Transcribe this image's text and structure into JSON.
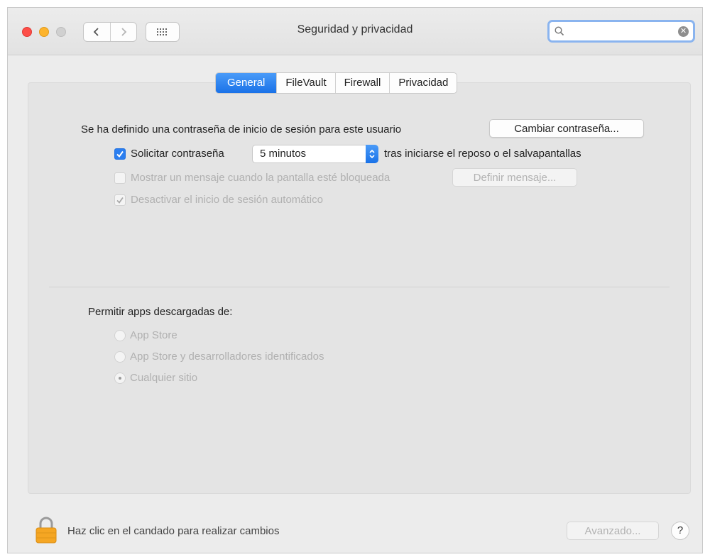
{
  "window": {
    "title": "Seguridad y privacidad"
  },
  "search": {
    "placeholder": "",
    "value": ""
  },
  "tabs": [
    {
      "label": "General",
      "active": true
    },
    {
      "label": "FileVault",
      "active": false
    },
    {
      "label": "Firewall",
      "active": false
    },
    {
      "label": "Privacidad",
      "active": false
    }
  ],
  "general": {
    "password_set_text": "Se ha definido una contraseña de inicio de sesión para este usuario",
    "change_password_button": "Cambiar contraseña...",
    "require_password_label": "Solicitar contraseña",
    "require_password_checked": true,
    "require_password_delay": "5 minutos",
    "require_password_suffix": "tras iniciarse el reposo o el salvapantallas",
    "show_message_label": "Mostrar un mensaje cuando la pantalla esté bloqueada",
    "show_message_checked": false,
    "set_message_button": "Definir mensaje...",
    "disable_autologin_label": "Desactivar el inicio de sesión automático",
    "disable_autologin_checked": true
  },
  "downloads": {
    "heading": "Permitir apps descargadas de:",
    "options": [
      {
        "label": "App Store",
        "selected": false
      },
      {
        "label": "App Store y desarrolladores identificados",
        "selected": false
      },
      {
        "label": "Cualquier sitio",
        "selected": true
      }
    ]
  },
  "footer": {
    "lock_text": "Haz clic en el candado para realizar cambios",
    "advanced_button": "Avanzado...",
    "help_label": "?"
  },
  "colors": {
    "accent": "#1a72e8",
    "close": "#fd4e48",
    "minimize": "#fdb42d",
    "lock": "#f5a623"
  }
}
